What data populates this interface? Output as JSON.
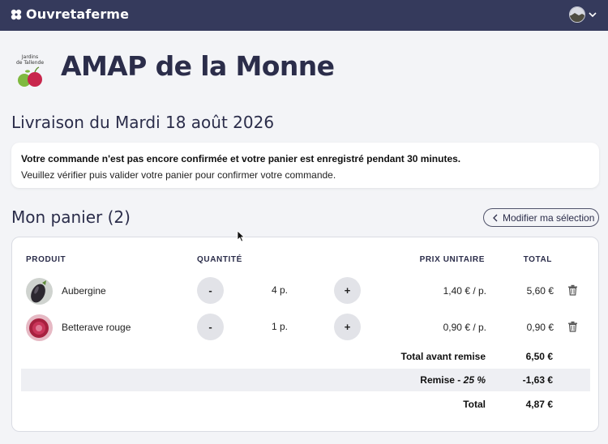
{
  "topbar": {
    "brand": "Ouvretaferme",
    "icon": "clover-icon",
    "user_icon": "avatar-landscape"
  },
  "header": {
    "logo_line1": "Jardins",
    "logo_line2": "de Tallende",
    "title": "AMAP de la Monne"
  },
  "delivery": {
    "title": "Livraison du Mardi 18 août 2026"
  },
  "notice": {
    "strong": "Votre commande n'est pas encore confirmée et votre panier est enregistré pendant 30 minutes.",
    "text": "Veuillez vérifier puis valider votre panier pour confirmer votre commande."
  },
  "cart": {
    "heading": "Mon panier (2)",
    "modify_label": "Modifier ma sélection",
    "columns": {
      "product": "PRODUIT",
      "quantity": "QUANTITÉ",
      "unit_price": "PRIX UNITAIRE",
      "total": "TOTAL"
    },
    "items": [
      {
        "name": "Aubergine",
        "minus": "-",
        "qty": "4 p.",
        "plus": "+",
        "unit_price": "1,40 € / p.",
        "total": "5,60 €",
        "color": "#3b3640"
      },
      {
        "name": "Betterave rouge",
        "minus": "-",
        "qty": "1 p.",
        "plus": "+",
        "unit_price": "0,90 € / p.",
        "total": "0,90 €",
        "color": "#b3274f"
      }
    ],
    "summary": {
      "subtotal_label": "Total avant remise",
      "subtotal": "6,50 €",
      "discount_label": "Remise - ",
      "discount_pct": "25 %",
      "discount": "-1,63 €",
      "total_label": "Total",
      "total": "4,87 €"
    }
  },
  "colors": {
    "topbar": "#353a5c",
    "title": "#2b2d4a",
    "background": "#f3f4f7",
    "apple_green": "#7fb93f",
    "apple_red": "#c8264c"
  }
}
